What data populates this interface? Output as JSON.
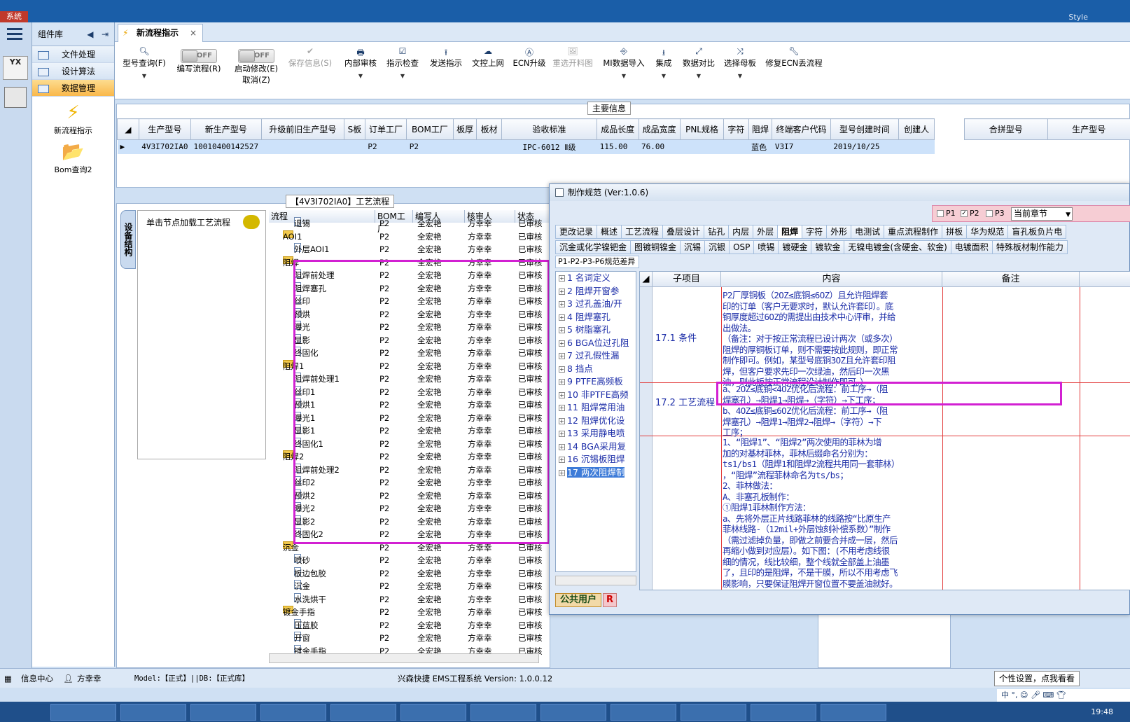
{
  "top": {
    "system_label": "系统",
    "style_label": "Style"
  },
  "component_panel": {
    "title": "组件库",
    "nav": [
      {
        "label": "文件处理"
      },
      {
        "label": "设计算法"
      },
      {
        "label": "数据管理"
      }
    ],
    "tools": [
      {
        "label": "新流程指示",
        "icon": "lightning-icon"
      },
      {
        "label": "Bom查询2",
        "icon": "folder-icon"
      }
    ]
  },
  "left_rail": {
    "logo": "YX"
  },
  "tab": {
    "title": "新流程指示",
    "close": "×"
  },
  "ribbon": {
    "items": [
      {
        "label": "型号查询(F)",
        "icon": "search-icon"
      },
      {
        "label": "编写流程(R)",
        "toggle": "OFF"
      },
      {
        "label": "启动修改(E)",
        "sub": "取消(Z)",
        "toggle": "OFF"
      },
      {
        "label": "保存信息(S)",
        "icon": "check-icon",
        "disabled": true
      },
      {
        "label": "内部审核",
        "icon": "printer-icon"
      },
      {
        "label": "指示检查",
        "icon": "checkbox-icon"
      },
      {
        "label": "发送指示",
        "icon": "upload-icon"
      },
      {
        "label": "文控上网",
        "icon": "cloud-icon"
      },
      {
        "label": "ECN升级",
        "icon": "ecn-icon"
      },
      {
        "label": "重选开料图",
        "icon": "image-icon",
        "disabled": true
      },
      {
        "label": "MI数据导入",
        "icon": "import-icon"
      },
      {
        "label": "集成",
        "icon": "download-icon"
      },
      {
        "label": "数据对比",
        "icon": "compare-icon"
      },
      {
        "label": "选择母板",
        "icon": "shuffle-icon"
      },
      {
        "label": "修复ECN丢流程",
        "icon": "wrench-icon"
      }
    ]
  },
  "main_info": {
    "title": "主要信息",
    "columns": [
      "生产型号",
      "新生产型号",
      "升级前旧生产型号",
      "S板",
      "订单工厂",
      "BOM工厂",
      "板厚",
      "板材",
      "验收标准",
      "成品长度",
      "成品宽度",
      "PNL规格",
      "字符",
      "阻焊",
      "终端客户代码",
      "型号创建时间",
      "创建人"
    ],
    "row": [
      "4V3I702IA0",
      "10010400142527",
      "",
      "",
      "P2",
      "P2",
      "",
      "",
      "IPC-6012 Ⅱ级",
      "115.00",
      "76.00",
      "",
      "",
      "蓝色",
      "V3I7",
      "2019/10/25",
      ""
    ],
    "right_columns": [
      "合拼型号",
      "生产型号"
    ]
  },
  "flow": {
    "title": "【4V3I702IA0】工艺流程",
    "vertical_tab": "设备结构",
    "hint": "单击节点加载工艺流程",
    "columns": [
      "流程",
      "BOM工厂",
      "编写人",
      "核审人",
      "状态"
    ],
    "rows": [
      {
        "name": "退锡",
        "level": 2,
        "type": "doc",
        "factory": "P2",
        "writer": "全宏艳",
        "reviewer": "方幸幸",
        "status": "已审核"
      },
      {
        "name": "AOI1",
        "level": 1,
        "type": "folder",
        "factory": "P2",
        "writer": "全宏艳",
        "reviewer": "方幸幸",
        "status": "已审核"
      },
      {
        "name": "外层AOI1",
        "level": 2,
        "type": "doc",
        "factory": "P2",
        "writer": "全宏艳",
        "reviewer": "方幸幸",
        "status": "已审核"
      },
      {
        "name": "阻焊",
        "level": 1,
        "type": "folder",
        "factory": "P2",
        "writer": "全宏艳",
        "reviewer": "方幸幸",
        "status": "已审核"
      },
      {
        "name": "阻焊前处理",
        "level": 2,
        "type": "doc",
        "factory": "P2",
        "writer": "全宏艳",
        "reviewer": "方幸幸",
        "status": "已审核"
      },
      {
        "name": "阻焊塞孔",
        "level": 2,
        "type": "doc",
        "factory": "P2",
        "writer": "全宏艳",
        "reviewer": "方幸幸",
        "status": "已审核"
      },
      {
        "name": "丝印",
        "level": 2,
        "type": "doc",
        "factory": "P2",
        "writer": "全宏艳",
        "reviewer": "方幸幸",
        "status": "已审核"
      },
      {
        "name": "预烘",
        "level": 2,
        "type": "doc",
        "factory": "P2",
        "writer": "全宏艳",
        "reviewer": "方幸幸",
        "status": "已审核"
      },
      {
        "name": "曝光",
        "level": 2,
        "type": "doc",
        "factory": "P2",
        "writer": "全宏艳",
        "reviewer": "方幸幸",
        "status": "已审核"
      },
      {
        "name": "显影",
        "level": 2,
        "type": "doc",
        "factory": "P2",
        "writer": "全宏艳",
        "reviewer": "方幸幸",
        "status": "已审核"
      },
      {
        "name": "终固化",
        "level": 2,
        "type": "doc",
        "factory": "P2",
        "writer": "全宏艳",
        "reviewer": "方幸幸",
        "status": "已审核"
      },
      {
        "name": "阻焊1",
        "level": 1,
        "type": "folder",
        "factory": "P2",
        "writer": "全宏艳",
        "reviewer": "方幸幸",
        "status": "已审核"
      },
      {
        "name": "阻焊前处理1",
        "level": 2,
        "type": "doc",
        "factory": "P2",
        "writer": "全宏艳",
        "reviewer": "方幸幸",
        "status": "已审核"
      },
      {
        "name": "丝印1",
        "level": 2,
        "type": "doc",
        "factory": "P2",
        "writer": "全宏艳",
        "reviewer": "方幸幸",
        "status": "已审核"
      },
      {
        "name": "预烘1",
        "level": 2,
        "type": "doc",
        "factory": "P2",
        "writer": "全宏艳",
        "reviewer": "方幸幸",
        "status": "已审核"
      },
      {
        "name": "曝光1",
        "level": 2,
        "type": "doc",
        "factory": "P2",
        "writer": "全宏艳",
        "reviewer": "方幸幸",
        "status": "已审核"
      },
      {
        "name": "显影1",
        "level": 2,
        "type": "doc",
        "factory": "P2",
        "writer": "全宏艳",
        "reviewer": "方幸幸",
        "status": "已审核"
      },
      {
        "name": "终固化1",
        "level": 2,
        "type": "doc",
        "factory": "P2",
        "writer": "全宏艳",
        "reviewer": "方幸幸",
        "status": "已审核"
      },
      {
        "name": "阻焊2",
        "level": 1,
        "type": "folder",
        "factory": "P2",
        "writer": "全宏艳",
        "reviewer": "方幸幸",
        "status": "已审核"
      },
      {
        "name": "阻焊前处理2",
        "level": 2,
        "type": "doc",
        "factory": "P2",
        "writer": "全宏艳",
        "reviewer": "方幸幸",
        "status": "已审核"
      },
      {
        "name": "丝印2",
        "level": 2,
        "type": "doc",
        "factory": "P2",
        "writer": "全宏艳",
        "reviewer": "方幸幸",
        "status": "已审核"
      },
      {
        "name": "预烘2",
        "level": 2,
        "type": "doc",
        "factory": "P2",
        "writer": "全宏艳",
        "reviewer": "方幸幸",
        "status": "已审核"
      },
      {
        "name": "曝光2",
        "level": 2,
        "type": "doc",
        "factory": "P2",
        "writer": "全宏艳",
        "reviewer": "方幸幸",
        "status": "已审核"
      },
      {
        "name": "显影2",
        "level": 2,
        "type": "doc",
        "factory": "P2",
        "writer": "全宏艳",
        "reviewer": "方幸幸",
        "status": "已审核"
      },
      {
        "name": "终固化2",
        "level": 2,
        "type": "doc",
        "factory": "P2",
        "writer": "全宏艳",
        "reviewer": "方幸幸",
        "status": "已审核"
      },
      {
        "name": "沉金",
        "level": 1,
        "type": "folder",
        "factory": "P2",
        "writer": "全宏艳",
        "reviewer": "方幸幸",
        "status": "已审核"
      },
      {
        "name": "喷砂",
        "level": 2,
        "type": "doc",
        "factory": "P2",
        "writer": "全宏艳",
        "reviewer": "方幸幸",
        "status": "已审核"
      },
      {
        "name": "板边包胶",
        "level": 2,
        "type": "doc",
        "factory": "P2",
        "writer": "全宏艳",
        "reviewer": "方幸幸",
        "status": "已审核"
      },
      {
        "name": "沉金",
        "level": 2,
        "type": "doc",
        "factory": "P2",
        "writer": "全宏艳",
        "reviewer": "方幸幸",
        "status": "已审核"
      },
      {
        "name": "水洗烘干",
        "level": 2,
        "type": "doc",
        "factory": "P2",
        "writer": "全宏艳",
        "reviewer": "方幸幸",
        "status": "已审核"
      },
      {
        "name": "镀金手指",
        "level": 1,
        "type": "folder",
        "factory": "P2",
        "writer": "全宏艳",
        "reviewer": "方幸幸",
        "status": "已审核"
      },
      {
        "name": "压蓝胶",
        "level": 2,
        "type": "doc",
        "factory": "P2",
        "writer": "全宏艳",
        "reviewer": "方幸幸",
        "status": "已审核"
      },
      {
        "name": "开窗",
        "level": 2,
        "type": "doc",
        "factory": "P2",
        "writer": "全宏艳",
        "reviewer": "方幸幸",
        "status": "已审核"
      },
      {
        "name": "镀金手指",
        "level": 2,
        "type": "doc",
        "factory": "P2",
        "writer": "全宏艳",
        "reviewer": "方幸幸",
        "status": "已审核"
      }
    ]
  },
  "dialog": {
    "title": "制作规范 (Ver:1.0.6)",
    "options": {
      "p1": "P1",
      "p2": "P2",
      "p3": "P3",
      "scope": "当前章节"
    },
    "tabs_row1": [
      "更改记录",
      "概述",
      "工艺流程",
      "叠层设计",
      "钻孔",
      "内层",
      "外层",
      "阻焊",
      "字符",
      "外形",
      "电测试",
      "重点流程制作",
      "拼板",
      "华为规范",
      "盲孔板负片电"
    ],
    "tabs_row2": [
      "沉金或化学镍钯金",
      "图镀铜镍金",
      "沉锡",
      "沉银",
      "OSP",
      "喷锡",
      "镀硬金",
      "镀软金",
      "无镍电镀金(含硬金、软金)",
      "电镀面积",
      "特殊板材制作能力"
    ],
    "diff_tab": "P1-P2-P3-P6规范差异",
    "toc": [
      "1 名词定义",
      "2 阻焊开窗参",
      "3 过孔盖油/开",
      "4 阻焊塞孔",
      "5 树脂塞孔",
      "6 BGA位过孔阻",
      "7 过孔假性漏",
      "8 挡点",
      "9 PTFE高频板",
      "10 非PTFE高频",
      "11 阻焊常用油",
      "12 阻焊优化设",
      "13 采用静电喷",
      "14 BGA采用复",
      "16 沉锡板阻焊",
      "17 两次阻焊制"
    ],
    "columns": [
      "子项目",
      "内容",
      "备注"
    ],
    "rows": [
      {
        "sub": "17.1 条件",
        "content": [
          "P2厂厚铜板（2OZ≤底铜≤6OZ）且允许阻焊套",
          "印的订单（客户无要求时，默认允许套印）。底",
          "铜厚度超过6OZ的需提出由技术中心评审，并给",
          "出做法。",
          "（备注：对于按正常流程已设计两次（或多次）",
          "阻焊的厚铜板订单，则不需要按此规则，即正常",
          "制作即可。例如，某型号底铜3OZ且允许套印阻",
          "焊，但客户要求先印一次绿油，然后印一次黑",
          "油，则此板按正常流程设计制作即可。）"
        ]
      },
      {
        "sub": "17.2 工艺流程",
        "content": [
          "a、2OZ≤底铜<4OZ优化后流程：前工序→（阻",
          "焊塞孔）→阻焊1→阻焊→（字符）→下工序；",
          "b、4OZ≤底铜≤6OZ优化后流程：前工序→（阻",
          "焊塞孔）→阻焊1→阻焊2→阻焊→（字符）→下",
          "工序；"
        ]
      },
      {
        "sub": "",
        "content": [
          "1、“阻焊1”、“阻焊2”两次使用的菲林为增",
          "加的对基材菲林，菲林后缀命名分别为：",
          "ts1/bs1（阻焊1和阻焊2流程共用同一套菲林）",
          "，“阻焊”流程菲林命名为ts/bs；",
          "2、菲林做法：",
          "A、非塞孔板制作：",
          "①阻焊1菲林制作方法：",
          "a、先将外层正片线路菲林的线路按“比原生产",
          "菲林线路-（12mil+外层蚀刻补偿系数）”制作",
          "（需过滤掉负量，即做之前要合并成一层，然后",
          "再缩小做到对应层）。如下图：(不用考虑线很",
          "细的情况，线比较细，整个线就全部盖上油墨",
          "了，且印的是阻焊，不是干膜，所以不用考虑飞",
          "膜影响，只要保证阻焊开窗位置不要盖油就好。",
          "）"
        ]
      }
    ],
    "user": "公共用户",
    "user_flag": "R"
  },
  "status": {
    "info_center": "信息中心",
    "user": "方幸幸",
    "model": "Model:【正式】||DB:【正式库】",
    "app": "兴森快捷 EMS工程系统 Version: 1.0.0.12",
    "tooltip": "个性设置，点我看看"
  },
  "taskbar": {
    "clock": "19:48"
  }
}
